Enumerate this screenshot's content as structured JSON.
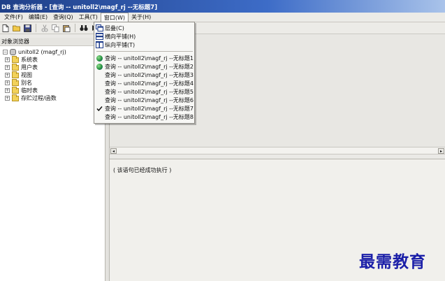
{
  "window": {
    "title": "DB 查询分析器 - [查询 -- unitoll2\\magf_rj --无标题7]"
  },
  "menubar": {
    "items": [
      {
        "label": "文件(F)"
      },
      {
        "label": "编辑(E)"
      },
      {
        "label": "查询(Q)"
      },
      {
        "label": "工具(T)"
      },
      {
        "label": "窗口(W)"
      },
      {
        "label": "关于(H)"
      }
    ]
  },
  "explorer": {
    "title": "对象浏览器",
    "root": "unitoll2 (magf_rj)",
    "nodes": [
      {
        "label": "系统表"
      },
      {
        "label": "用户表"
      },
      {
        "label": "视图"
      },
      {
        "label": "别名"
      },
      {
        "label": "临时表"
      },
      {
        "label": "存贮过程/函数"
      }
    ]
  },
  "window_menu": {
    "arrange_items": [
      {
        "label": "层叠(C)",
        "icon": "cascade-icon"
      },
      {
        "label": "横向平铺(H)",
        "icon": "tile-horizontal-icon"
      },
      {
        "label": "纵向平铺(T)",
        "icon": "tile-vertical-icon"
      }
    ],
    "windows": [
      {
        "label": "查询 -- unitoll2\\magf_rj --无标题1",
        "icon": "globe"
      },
      {
        "label": "查询 -- unitoll2\\magf_rj --无标题2",
        "icon": "globe"
      },
      {
        "label": "查询 -- unitoll2\\magf_rj --无标题3",
        "icon": ""
      },
      {
        "label": "查询 -- unitoll2\\magf_rj --无标题4",
        "icon": ""
      },
      {
        "label": "查询 -- unitoll2\\magf_rj --无标题5",
        "icon": ""
      },
      {
        "label": "查询 -- unitoll2\\magf_rj --无标题6",
        "icon": ""
      },
      {
        "label": "查询 -- unitoll2\\magf_rj --无标题7",
        "icon": "check"
      },
      {
        "label": "查询 -- unitoll2\\magf_rj --无标题8",
        "icon": ""
      }
    ]
  },
  "results": {
    "message": "( 该语句已经成功执行 )"
  },
  "watermark": {
    "text": "最需教育"
  },
  "colors": {
    "title_bar": "#2a55a8",
    "watermark": "#1b1fa8"
  }
}
